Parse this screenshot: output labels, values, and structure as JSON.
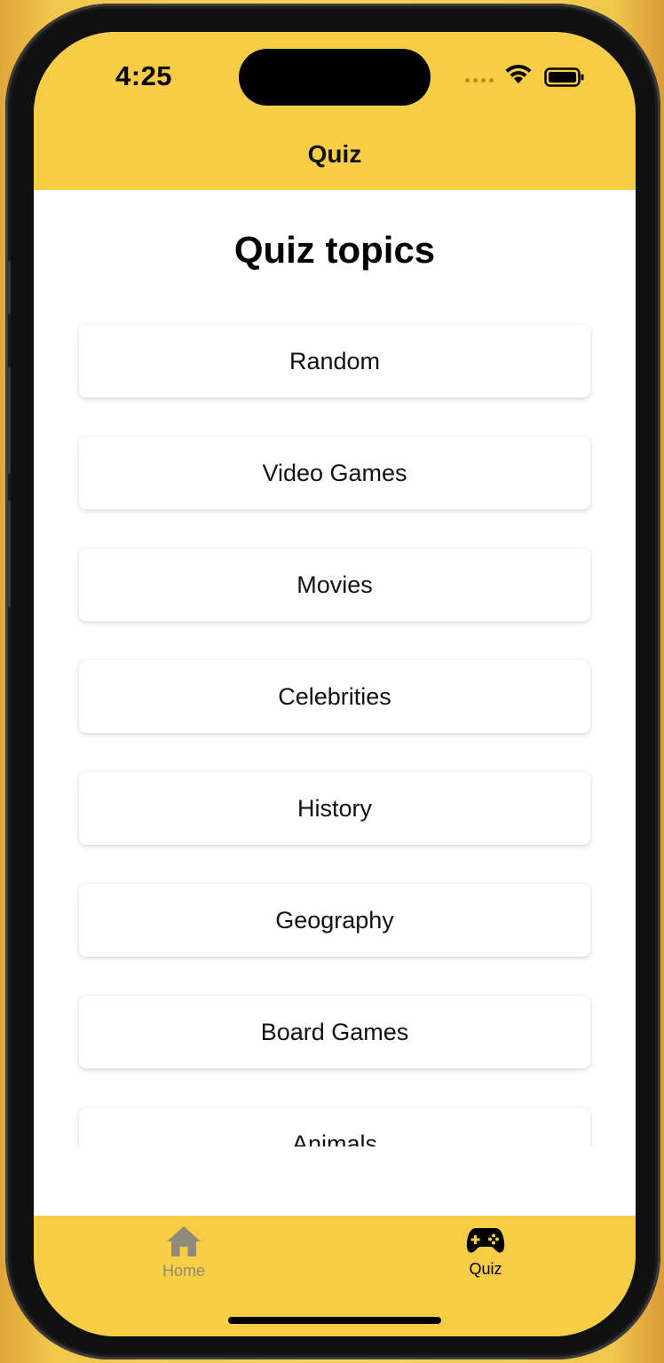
{
  "status_bar": {
    "time": "4:25"
  },
  "nav": {
    "title": "Quiz"
  },
  "page": {
    "title": "Quiz topics"
  },
  "topics": [
    "Random",
    "Video Games",
    "Movies",
    "Celebrities",
    "History",
    "Geography",
    "Board Games",
    "Animals"
  ],
  "tabbar": {
    "home_label": "Home",
    "quiz_label": "Quiz",
    "active_tab": "Quiz"
  },
  "colors": {
    "accent": "#f8cd46",
    "inactive_tab": "#8f8a7c",
    "active_tab": "#000000"
  },
  "icons": {
    "home_tab": "home-icon",
    "quiz_tab": "gamepad-icon",
    "wifi": "wifi-icon",
    "battery": "battery-icon"
  }
}
